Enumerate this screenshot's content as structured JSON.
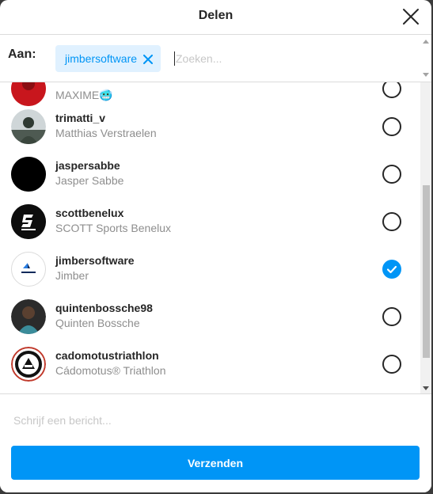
{
  "dialog": {
    "title": "Delen"
  },
  "recipients": {
    "to_label": "Aan:",
    "chips": [
      {
        "label": "jimbersoftware"
      }
    ],
    "search_placeholder": "Zoeken..."
  },
  "users": [
    {
      "username": "",
      "fullname": "MAXIME🥶",
      "selected": false,
      "avatar": "red-avatar"
    },
    {
      "username": "trimatti_v",
      "fullname": "Matthias Verstraelen",
      "selected": false,
      "avatar": "photo-avatar"
    },
    {
      "username": "jaspersabbe",
      "fullname": "Jasper Sabbe",
      "selected": false,
      "avatar": "black-avatar"
    },
    {
      "username": "scottbenelux",
      "fullname": "SCOTT Sports Benelux",
      "selected": false,
      "avatar": "scott-logo-avatar"
    },
    {
      "username": "jimbersoftware",
      "fullname": "Jimber",
      "selected": true,
      "avatar": "jimber-logo-avatar"
    },
    {
      "username": "quintenbossche98",
      "fullname": "Quinten Bossche",
      "selected": false,
      "avatar": "photo-avatar"
    },
    {
      "username": "cadomotustriathlon",
      "fullname": "Cádomotus® Triathlon",
      "selected": false,
      "avatar": "cadomotus-logo-avatar"
    }
  ],
  "footer": {
    "message_placeholder": "Schrijf een bericht...",
    "send_label": "Verzenden"
  },
  "colors": {
    "accent": "#0095f6",
    "chip_bg": "#e0f1ff",
    "secondary_text": "#8e8e8e",
    "divider": "#dbdbdb"
  }
}
